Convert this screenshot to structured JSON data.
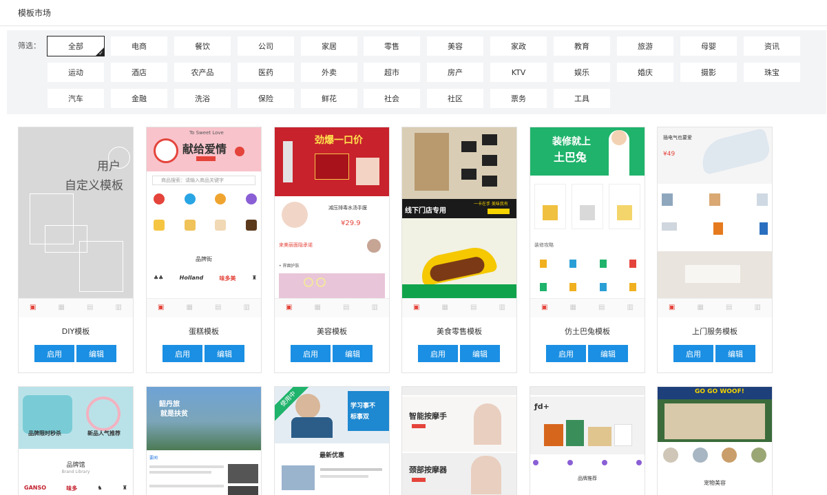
{
  "header": {
    "title": "模板市场"
  },
  "filter": {
    "label": "筛选：",
    "rows": [
      [
        "全部",
        "电商",
        "餐饮",
        "公司",
        "家居",
        "零售",
        "美容",
        "家政",
        "教育",
        "旅游",
        "母婴",
        "资讯"
      ],
      [
        "运动",
        "酒店",
        "农产品",
        "医药",
        "外卖",
        "超市",
        "房产",
        "KTV",
        "娱乐",
        "婚庆",
        "摄影",
        "珠宝"
      ],
      [
        "汽车",
        "金融",
        "洗浴",
        "保险",
        "鲜花",
        "社会",
        "社区",
        "票务",
        "工具"
      ]
    ]
  },
  "common": {
    "enable_label": "启用",
    "edit_label": "编辑"
  },
  "cards": [
    {
      "title": "DIY模板",
      "line1": "用户",
      "line2": "自定义模板"
    },
    {
      "title": "蛋糕模板",
      "banner": "献给爱情",
      "banner_small": "To Sweet Love",
      "search_placeholder": "商品搜索：请输入商品关键字",
      "section": "品牌街"
    },
    {
      "title": "美容模板",
      "banner": "劲爆一口价",
      "product": "减压排毒水汤手膜",
      "price": "¥29.9",
      "promo": "来美丽面隐承诺"
    },
    {
      "title": "美食零售模板",
      "banner": "线下门店专用",
      "promo": "一卡在手 美味我有"
    },
    {
      "title": "仿土巴兔模板",
      "banner1": "装修就上",
      "banner2": "土巴兔",
      "section": "装修攻略"
    },
    {
      "title": "上门服务模板",
      "banner": "插电气也要爱",
      "price": "¥49"
    }
  ],
  "row2": [
    {
      "t1": "品牌限时秒杀",
      "t2": "新品人气推荐",
      "section": "品牌馆",
      "sub": "Brand Library"
    },
    {
      "t1": "韶丹旅",
      "t2": "就是扶贫",
      "tab": "要闻"
    },
    {
      "ribbon": "使用中",
      "t1": "学习事不",
      "t2": "标事双",
      "section": "最新优惠"
    },
    {
      "t1": "智能按摩手",
      "t2": "颈部按摩器"
    },
    {
      "t1": "ƒd+",
      "section": "品牌推荐"
    },
    {
      "t1": "GO GO WOOF!",
      "section": "宠物美容"
    }
  ],
  "colors": {
    "primary": "#1a8fe3",
    "accent": "#e4443b"
  }
}
